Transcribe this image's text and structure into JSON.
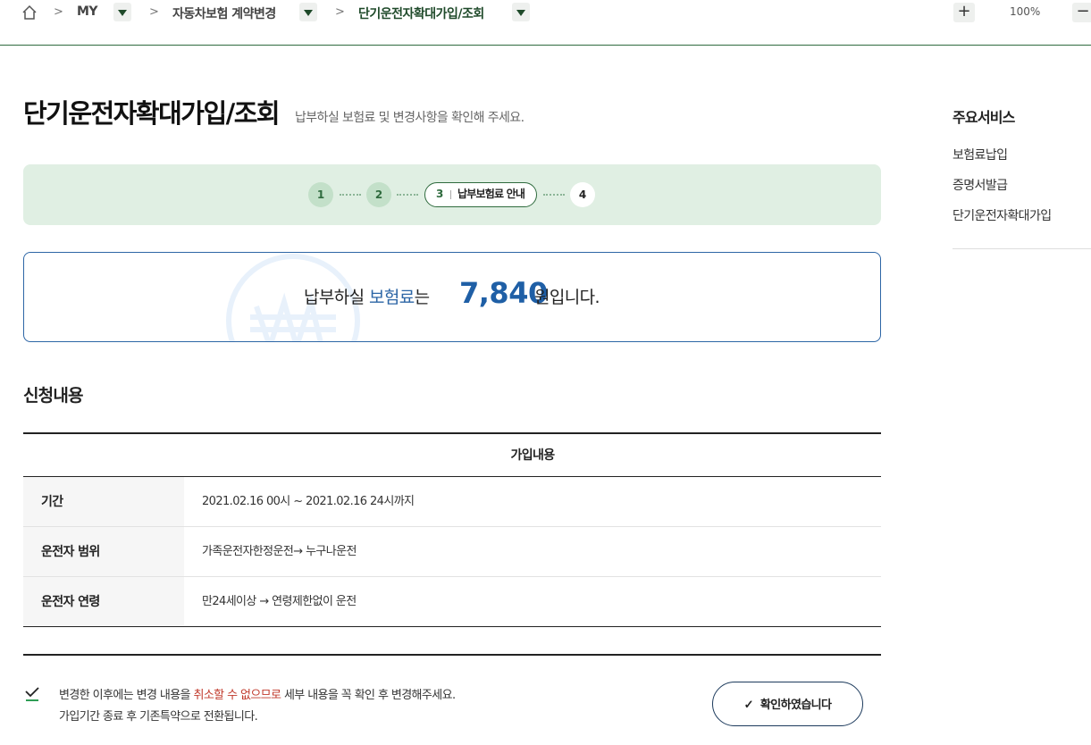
{
  "breadcrumb": {
    "items": [
      "MY",
      "자동차보험 계약변경",
      "단기운전자확대가입/조회"
    ],
    "separator": ">"
  },
  "zoom": {
    "plus": "+",
    "minus": "−",
    "level": "100%"
  },
  "page": {
    "title": "단기운전자확대가입/조회",
    "subtitle": "납부하실 보험료 및 변경사항을 확인해 주세요."
  },
  "steps": {
    "items": [
      "1",
      "2",
      "3",
      "4"
    ],
    "current": "3",
    "current_label": "납부보험료 안내"
  },
  "premium": {
    "prefix": "납부하실 ",
    "highlight": "보험료",
    "suffix": "는",
    "amount": "7,840",
    "tail": "원입니다."
  },
  "section": {
    "title": "신청내용",
    "table_header": "가입내용",
    "rows": [
      {
        "label": "기간",
        "value": "2021.02.16 00시 ~ 2021.02.16 24시까지"
      },
      {
        "label": "운전자 범위",
        "value": "가족운전자한정운전→ 누구나운전"
      },
      {
        "label": "운전자 연령",
        "value": "만24세이상 → 연령제한없이 운전"
      }
    ]
  },
  "notice": {
    "line1_before": "변경한 이후에는 변경 내용을 ",
    "line1_warn": "취소할 수 없으므로",
    "line1_after": " 세부 내용을 꼭 확인 후 변경해주세요.",
    "line2": "가입기간 종료 후 기존특약으로 전환됩니다."
  },
  "confirm_button": {
    "label": "확인하였습니다"
  },
  "side": {
    "title": "주요서비스",
    "items": [
      "보험료납입",
      "증명서발급",
      "단기운전자확대가입"
    ]
  },
  "colors": {
    "brand_green": "#2f6b3e",
    "steps_bg": "#e0efe3",
    "accent_blue": "#1f5fa6",
    "warn_red": "#c0392b"
  }
}
